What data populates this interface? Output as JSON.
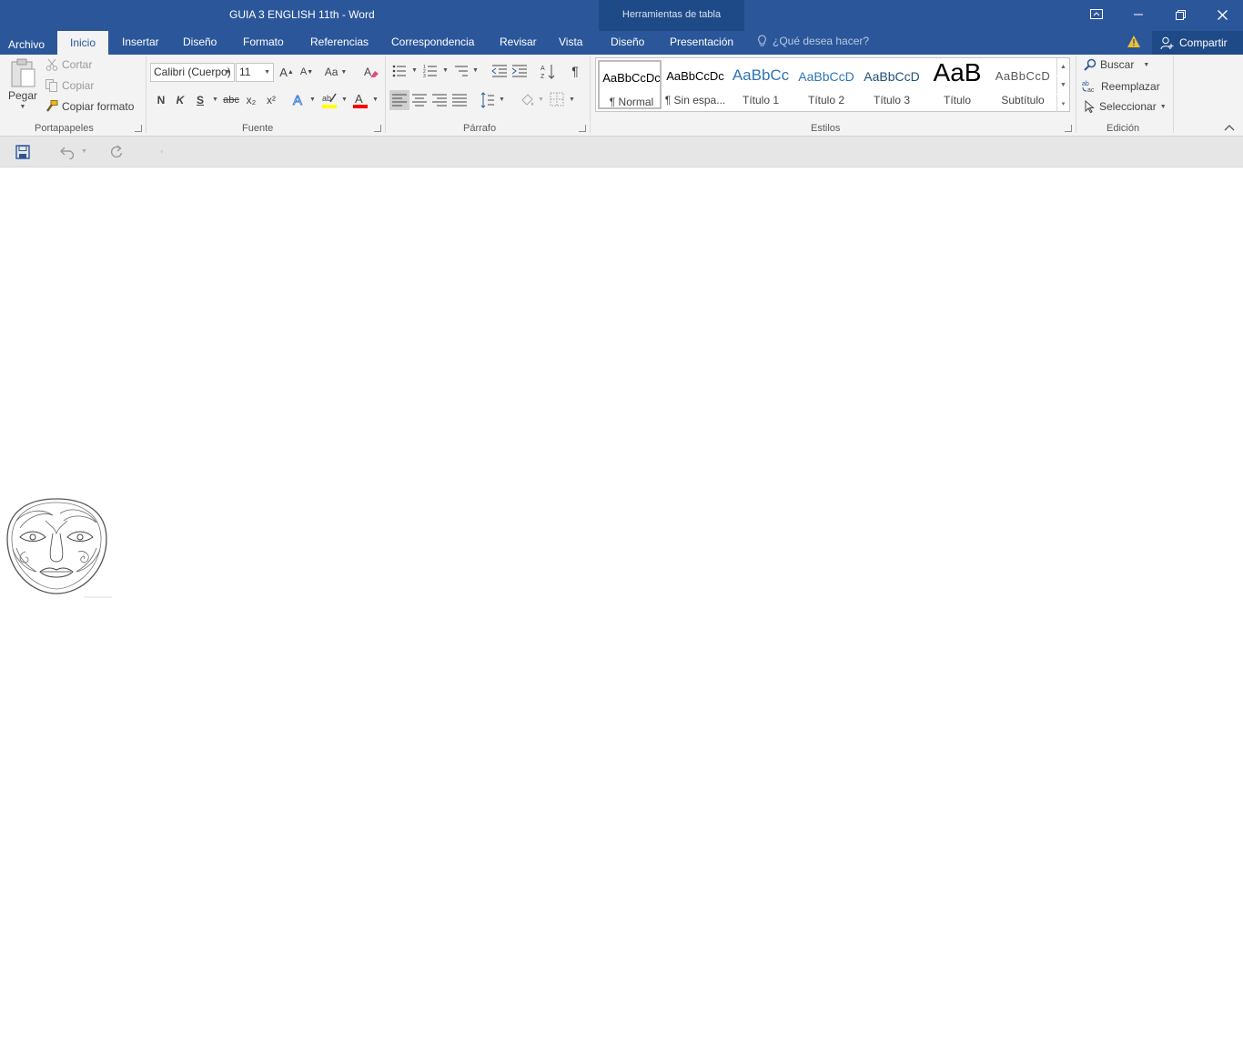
{
  "window": {
    "title": "GUIA 3  ENGLISH 11th - Word",
    "contextual_tab_group": "Herramientas de tabla",
    "controls": [
      "ribbon-display-icon",
      "minimize-icon",
      "restore-icon",
      "close-icon"
    ]
  },
  "tabs": [
    {
      "label": "Archivo",
      "active": false
    },
    {
      "label": "Inicio",
      "active": true
    },
    {
      "label": "Insertar",
      "active": false
    },
    {
      "label": "Diseño",
      "active": false
    },
    {
      "label": "Formato",
      "active": false
    },
    {
      "label": "Referencias",
      "active": false
    },
    {
      "label": "Correspondencia",
      "active": false
    },
    {
      "label": "Revisar",
      "active": false
    },
    {
      "label": "Vista",
      "active": false
    },
    {
      "label": "Diseño",
      "active": false,
      "contextual": true
    },
    {
      "label": "Presentación",
      "active": false,
      "contextual": true
    }
  ],
  "tell_me": {
    "placeholder": "¿Qué desea hacer?"
  },
  "share": {
    "label": "Compartir"
  },
  "clipboard": {
    "group_label": "Portapapeles",
    "paste": "Pegar",
    "cut": "Cortar",
    "copy": "Copiar",
    "format_painter": "Copiar formato"
  },
  "font": {
    "group_label": "Fuente",
    "font_name": "Calibri (Cuerpo)",
    "font_size": "11",
    "grow": "A",
    "shrink": "A",
    "change_case": "Aa",
    "bold": "N",
    "italic": "K",
    "underline": "S",
    "strikethrough": "abc",
    "subscript": "x₂",
    "superscript": "x²",
    "highlight_color": "#ffff00",
    "font_color": "#ff0000"
  },
  "paragraph": {
    "group_label": "Párrafo",
    "show_marks": "¶"
  },
  "styles": {
    "group_label": "Estilos",
    "items": [
      {
        "preview": "AaBbCcDc",
        "name": "¶ Normal",
        "color": "#000000",
        "selected": true
      },
      {
        "preview": "AaBbCcDc",
        "name": "¶ Sin espa...",
        "color": "#000000",
        "selected": false
      },
      {
        "preview": "AaBbCc",
        "name": "Título 1",
        "color": "#2e74b5",
        "selected": false
      },
      {
        "preview": "AaBbCcD",
        "name": "Título 2",
        "color": "#2e74b5",
        "selected": false
      },
      {
        "preview": "AaBbCcD",
        "name": "Título 3",
        "color": "#1f4e79",
        "selected": false
      },
      {
        "preview": "AaB",
        "name": "Título",
        "color": "#000000",
        "selected": false
      },
      {
        "preview": "AaBbCcD",
        "name": "Subtítulo",
        "color": "#595959",
        "selected": false
      }
    ]
  },
  "editing": {
    "group_label": "Edición",
    "find": "Buscar",
    "replace": "Reemplazar",
    "select": "Seleccionar"
  },
  "quick_access": [
    "save-icon",
    "undo-icon",
    "redo-icon"
  ]
}
